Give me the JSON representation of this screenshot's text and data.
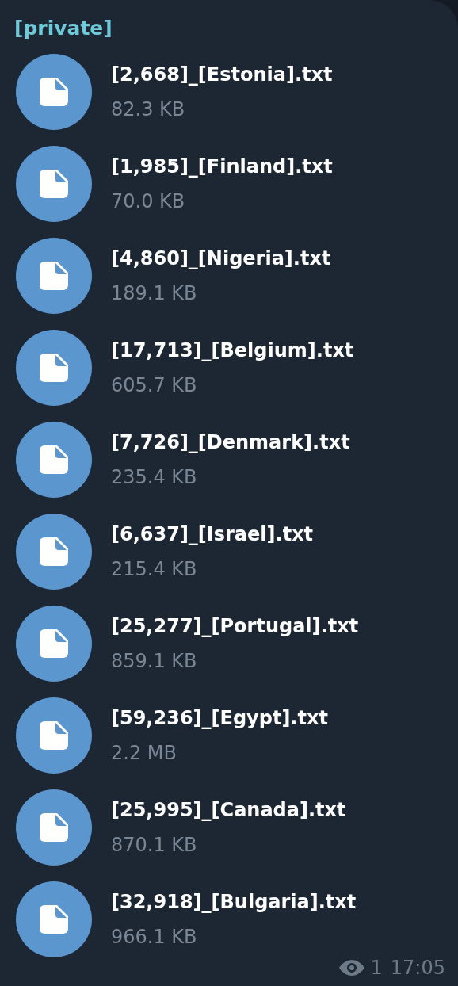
{
  "channel_label": "[private]",
  "files": [
    {
      "name": "[2,668]_[Estonia].txt",
      "size": "82.3 KB"
    },
    {
      "name": "[1,985]_[Finland].txt",
      "size": "70.0 KB"
    },
    {
      "name": "[4,860]_[Nigeria].txt",
      "size": "189.1 KB"
    },
    {
      "name": "[17,713]_[Belgium].txt",
      "size": "605.7 KB"
    },
    {
      "name": "[7,726]_[Denmark].txt",
      "size": "235.4 KB"
    },
    {
      "name": "[6,637]_[Israel].txt",
      "size": "215.4 KB"
    },
    {
      "name": "[25,277]_[Portugal].txt",
      "size": "859.1 KB"
    },
    {
      "name": "[59,236]_[Egypt].txt",
      "size": "2.2 MB"
    },
    {
      "name": "[25,995]_[Canada].txt",
      "size": "870.1 KB"
    },
    {
      "name": "[32,918]_[Bulgaria].txt",
      "size": "966.1 KB"
    }
  ],
  "footer": {
    "views": "1",
    "time": "17:05"
  }
}
